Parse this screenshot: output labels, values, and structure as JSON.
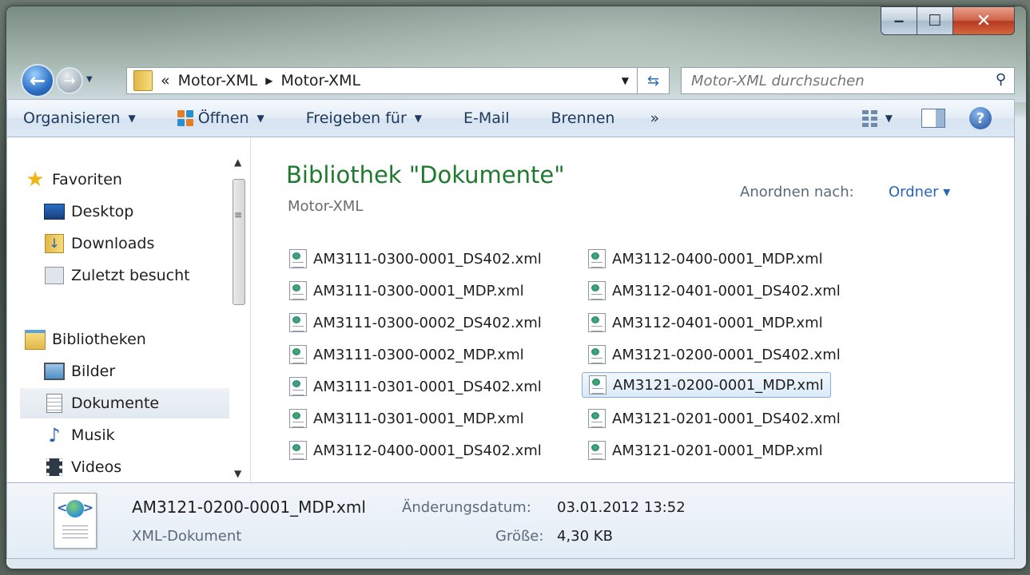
{
  "window": {
    "minimize": "‒",
    "maximize": "☐",
    "close": "✕"
  },
  "address": {
    "overflow": "«",
    "crumbs": [
      "Motor-XML",
      "Motor-XML"
    ],
    "separator": "▶"
  },
  "search": {
    "placeholder": "Motor-XML durchsuchen"
  },
  "toolbar": {
    "organize": "Organisieren",
    "open": "Öffnen",
    "share": "Freigeben für",
    "email": "E-Mail",
    "burn": "Brennen",
    "more": "»"
  },
  "nav": {
    "favorites": "Favoriten",
    "desktop": "Desktop",
    "downloads": "Downloads",
    "recent": "Zuletzt besucht",
    "libraries": "Bibliotheken",
    "pictures": "Bilder",
    "documents": "Dokumente",
    "music": "Musik",
    "videos": "Videos"
  },
  "library": {
    "title": "Bibliothek \"Dokumente\"",
    "subtitle": "Motor-XML",
    "arrange_label": "Anordnen nach:",
    "arrange_value": "Ordner ▾"
  },
  "files": [
    "AM3111-0300-0001_DS402.xml",
    "AM3111-0300-0001_MDP.xml",
    "AM3111-0300-0002_DS402.xml",
    "AM3111-0300-0002_MDP.xml",
    "AM3111-0301-0001_DS402.xml",
    "AM3111-0301-0001_MDP.xml",
    "AM3112-0400-0001_DS402.xml",
    "AM3112-0400-0001_MDP.xml",
    "AM3112-0401-0001_DS402.xml",
    "AM3112-0401-0001_MDP.xml",
    "AM3121-0200-0001_DS402.xml",
    "AM3121-0200-0001_MDP.xml",
    "AM3121-0201-0001_DS402.xml",
    "AM3121-0201-0001_MDP.xml"
  ],
  "selected_file": "AM3121-0200-0001_MDP.xml",
  "details": {
    "name": "AM3121-0200-0001_MDP.xml",
    "type": "XML-Dokument",
    "modified_label": "Änderungsdatum:",
    "modified_value": "03.01.2012 13:52",
    "size_label": "Größe:",
    "size_value": "4,30 KB"
  }
}
